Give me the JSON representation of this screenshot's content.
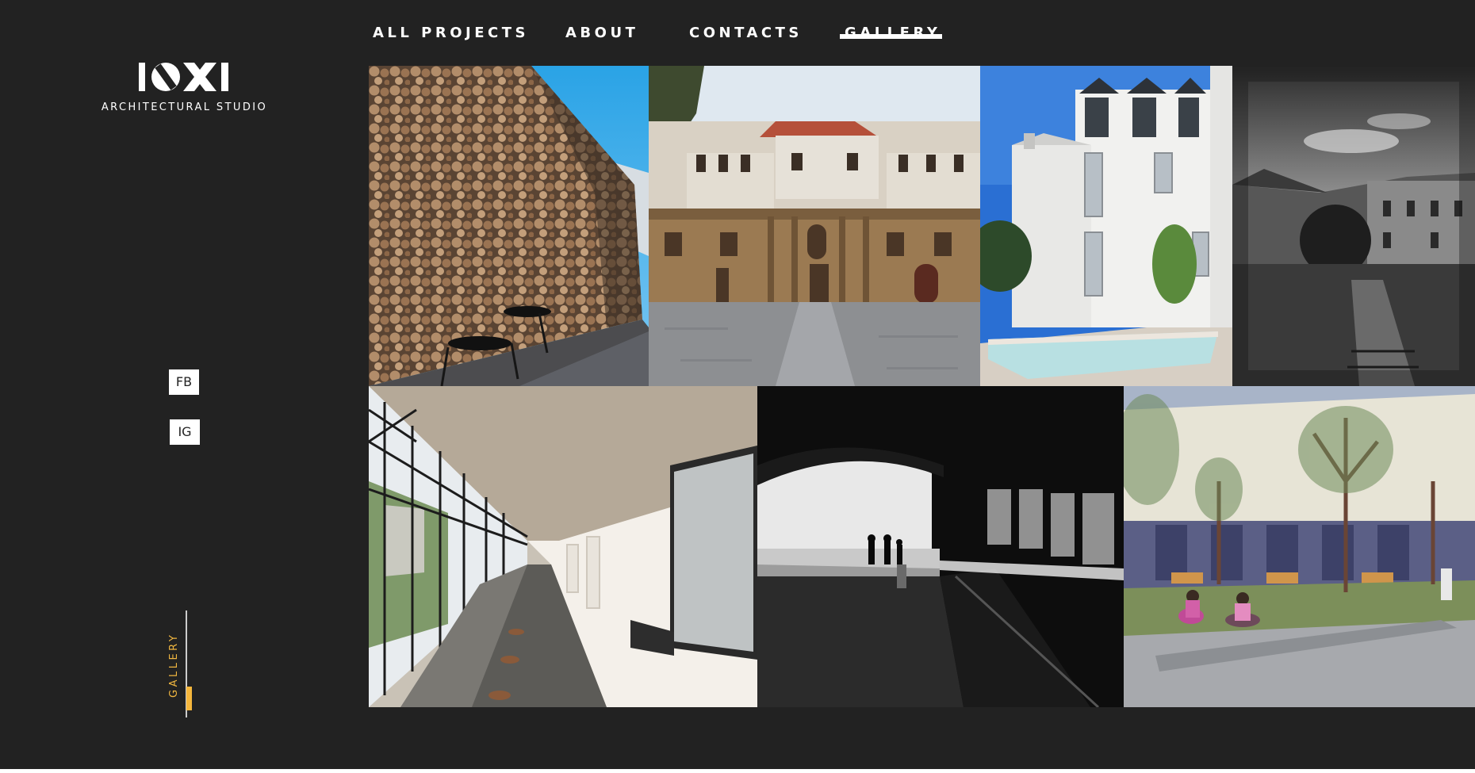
{
  "nav": {
    "items": [
      {
        "label": "ALL PROJECTS",
        "active": false
      },
      {
        "label": "ABOUT",
        "active": false
      },
      {
        "label": "CONTACTS",
        "active": false
      },
      {
        "label": "GALLERY",
        "active": true
      }
    ]
  },
  "logo": {
    "mark_text": "IOXI",
    "subtitle": "ARCHITECTURAL STUDIO"
  },
  "social": {
    "facebook_label": "FB",
    "instagram_label": "IG"
  },
  "section_indicator": {
    "label": "GALLERY"
  },
  "colors": {
    "background": "#222222",
    "accent": "#f5b63c",
    "text": "#ffffff"
  },
  "gallery": {
    "rows": [
      [
        "log-wall-photo",
        "baroque-monastery-facade-photo",
        "white-building-pool-photo",
        "bw-monastery-courtyard-photo"
      ],
      [
        "glass-corridor-photo",
        "dark-tunnel-silhouettes-photo",
        "plaza-render-photo"
      ]
    ]
  }
}
